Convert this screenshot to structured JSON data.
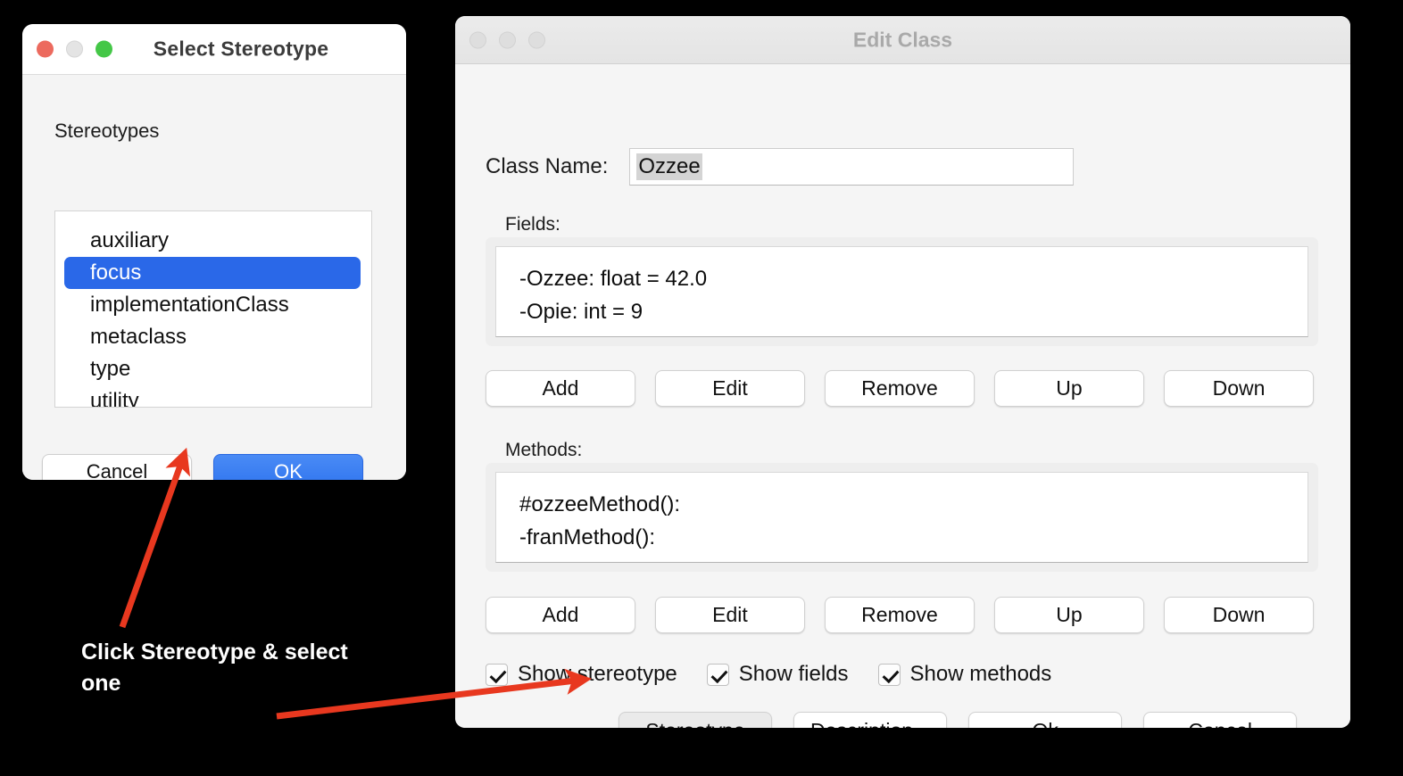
{
  "select_stereotype_window": {
    "title": "Select Stereotype",
    "traffic_lights": [
      "close",
      "minimize",
      "maximize"
    ],
    "list_label": "Stereotypes",
    "items": [
      {
        "label": "auxiliary",
        "selected": false
      },
      {
        "label": "focus",
        "selected": true
      },
      {
        "label": "implementationClass",
        "selected": false
      },
      {
        "label": "metaclass",
        "selected": false
      },
      {
        "label": "type",
        "selected": false
      },
      {
        "label": "utility",
        "selected": false
      }
    ],
    "selected_value": "focus",
    "cancel_label": "Cancel",
    "ok_label": "OK",
    "accent_color": "#2a68e8"
  },
  "edit_class_window": {
    "title": "Edit Class",
    "traffic_lights": [
      "close",
      "minimize",
      "maximize"
    ],
    "class_name_label": "Class Name:",
    "class_name_value": "Ozzee",
    "fields_label": "Fields:",
    "fields": [
      "-Ozzee: float = 42.0",
      "-Opie: int = 9"
    ],
    "fields_buttons": [
      "Add",
      "Edit",
      "Remove",
      "Up",
      "Down"
    ],
    "methods_label": "Methods:",
    "methods": [
      "#ozzeeMethod():",
      "-franMethod():"
    ],
    "methods_buttons": [
      "Add",
      "Edit",
      "Remove",
      "Up",
      "Down"
    ],
    "checkboxes": [
      {
        "label": "Show stereotype",
        "checked": true
      },
      {
        "label": "Show fields",
        "checked": true
      },
      {
        "label": "Show methods",
        "checked": true
      }
    ],
    "bottom_buttons": [
      {
        "label": "Stereotype",
        "pressed": true
      },
      {
        "label": "Description...",
        "pressed": false
      },
      {
        "label": "Ok",
        "pressed": false
      },
      {
        "label": "Cancel",
        "pressed": false
      }
    ]
  },
  "annotations": {
    "callout_text": "Click Stereotype & select one",
    "arrow_color": "#e8381f"
  }
}
